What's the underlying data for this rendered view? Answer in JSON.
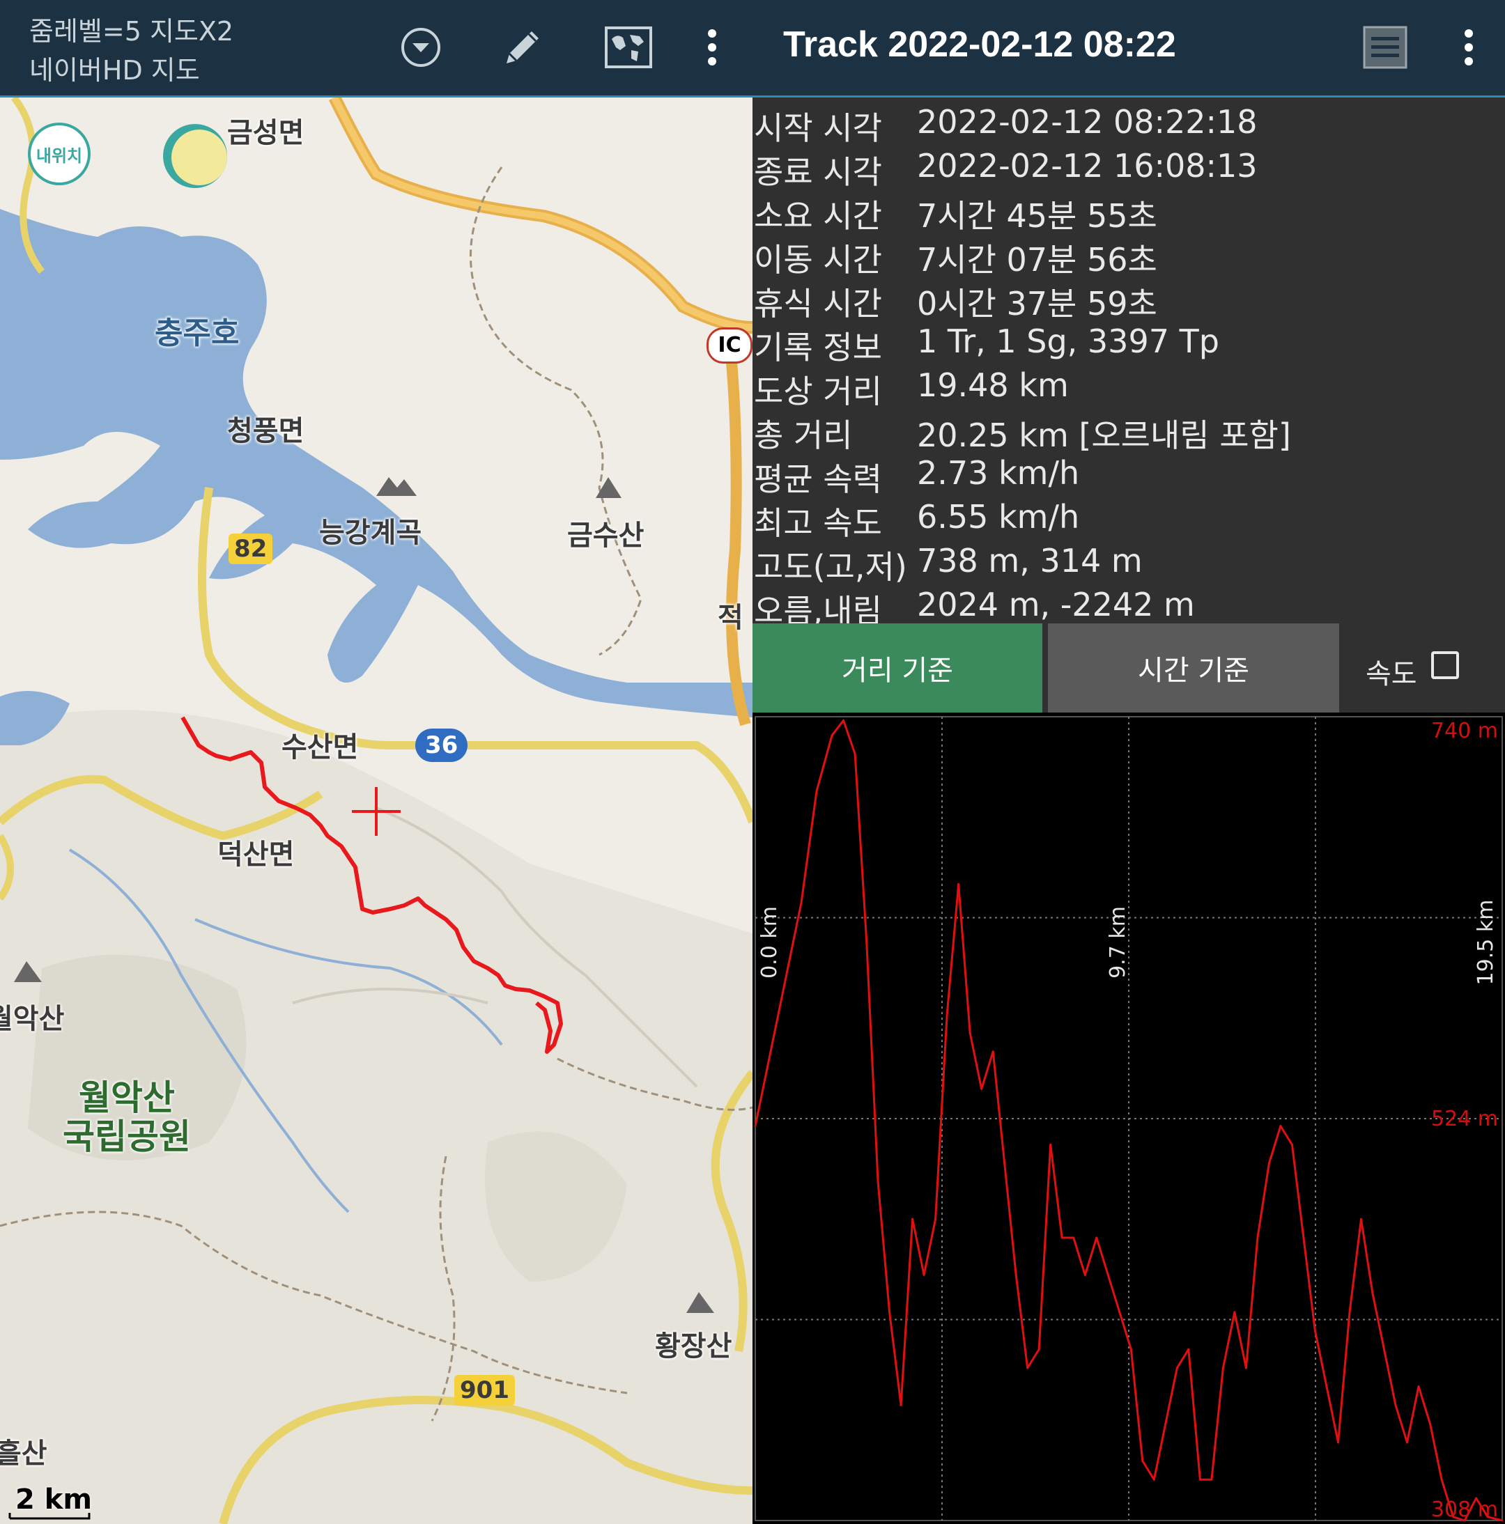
{
  "map_toolbar": {
    "zoom_text": "줌레벨=5 지도X2",
    "map_name": "네이버HD 지도",
    "icons": [
      "dropdown-circle-icon",
      "pencil-icon",
      "world-map-icon",
      "more-vert-icon"
    ]
  },
  "track_toolbar": {
    "title": "Track 2022-02-12 08:22",
    "icons": [
      "list-icon",
      "more-vert-icon"
    ]
  },
  "map": {
    "my_location_label": "내위치",
    "scale_label": "2 km",
    "places": {
      "geumseong": "금성면",
      "chungjuho": "충주호",
      "cheongpung": "청풍면",
      "neunggang": "능강계곡",
      "geumsusan": "금수산",
      "susan": "수산면",
      "deoksan": "덕산면",
      "wolaksan_partial": "월악산",
      "park_line1": "월악산",
      "park_line2": "국립공원",
      "hwangjangsan": "황장산",
      "heulsan_partial": "흘산",
      "jeok_partial": "적",
      "ic_label": "IC"
    },
    "road_numbers": {
      "r82": "82",
      "r36": "36",
      "r901": "901"
    }
  },
  "stats": [
    {
      "label": "시작 시각",
      "value": "2022-02-12 08:22:18"
    },
    {
      "label": "종료 시각",
      "value": "2022-02-12 16:08:13"
    },
    {
      "label": "소요 시간",
      "value": "7시간 45분 55초"
    },
    {
      "label": "이동 시간",
      "value": "7시간 07분 56초"
    },
    {
      "label": "휴식 시간",
      "value": "0시간 37분 59초"
    },
    {
      "label": "기록 정보",
      "value": "1 Tr, 1 Sg, 3397 Tp"
    },
    {
      "label": "도상 거리",
      "value": "19.48 km"
    },
    {
      "label": "총 거리",
      "value": "20.25 km [오르내림 포함]"
    },
    {
      "label": "평균 속력",
      "value": "2.73 km/h"
    },
    {
      "label": "최고 속도",
      "value": "6.55 km/h"
    },
    {
      "label": "고도(고,저)",
      "value": "738 m, 314 m"
    },
    {
      "label": "오름,내림",
      "value": "2024 m, -2242 m"
    }
  ],
  "tabs": {
    "distance": "거리 기준",
    "time": "시간 기준",
    "speed": "속도",
    "speed_checked": false
  },
  "colors": {
    "toolbar": "#1c3142",
    "accent_line": "#2a8bb8",
    "active_tab": "#3a8a5c",
    "inactive_tab": "#5a5a5a",
    "track": "#e8191c",
    "elevation_line": "#e01010"
  },
  "chart_data": {
    "type": "line",
    "series": [
      {
        "x": [
          0.0,
          0.4,
          0.8,
          1.2,
          1.6,
          2.0,
          2.3,
          2.6,
          2.9,
          3.2,
          3.5,
          3.8,
          4.1,
          4.4,
          4.7,
          5.0,
          5.3,
          5.6,
          5.9,
          6.2,
          6.5,
          6.8,
          7.1,
          7.4,
          7.7,
          8.0,
          8.3,
          8.6,
          8.9,
          9.2,
          9.5,
          9.8,
          10.1,
          10.4,
          10.7,
          11.0,
          11.3,
          11.6,
          11.9,
          12.2,
          12.5,
          12.8,
          13.1,
          13.4,
          13.7,
          14.0,
          14.3,
          14.6,
          14.9,
          15.2,
          15.5,
          15.8,
          16.1,
          16.4,
          16.7,
          17.0,
          17.3,
          17.6,
          17.9,
          18.2,
          18.5,
          18.8,
          19.1,
          19.48
        ],
        "y": [
          520,
          560,
          600,
          640,
          700,
          730,
          738,
          720,
          620,
          490,
          420,
          370,
          470,
          440,
          470,
          580,
          650,
          570,
          540,
          560,
          500,
          440,
          390,
          400,
          510,
          460,
          460,
          440,
          460,
          440,
          420,
          400,
          340,
          330,
          360,
          390,
          400,
          330,
          330,
          390,
          420,
          390,
          460,
          500,
          520,
          510,
          460,
          410,
          380,
          350,
          420,
          470,
          430,
          400,
          370,
          350,
          380,
          360,
          330,
          310,
          308,
          320,
          310,
          308
        ]
      }
    ],
    "xlabel_ticks": [
      "0.0 km",
      "9.7 km",
      "19.5 km"
    ],
    "ylabel_ticks": [
      "740 m",
      "524 m",
      "308 m"
    ],
    "xlim": [
      0,
      19.48
    ],
    "ylim": [
      308,
      740
    ],
    "grid": true
  }
}
